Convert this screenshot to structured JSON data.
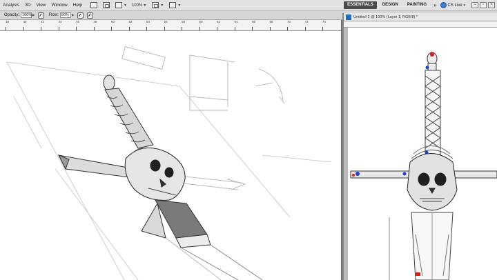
{
  "menubar": {
    "items": [
      "Analysis",
      "3D",
      "View",
      "Window",
      "Help"
    ],
    "zoom": "100%",
    "workspaces": [
      "ESSENTIALS",
      "DESIGN",
      "PAINTING"
    ],
    "more": "»",
    "cs_live": "CS Live"
  },
  "options": {
    "opacity_label": "Opacity:",
    "opacity_value": "100%",
    "flow_label": "Flow:",
    "flow_value": "80%"
  },
  "ruler": {
    "ticks": [
      "38",
      "40",
      "42",
      "44",
      "46",
      "48",
      "50",
      "52",
      "54",
      "56",
      "58",
      "60",
      "62",
      "64",
      "66",
      "68",
      "70",
      "72",
      "74"
    ]
  },
  "right_doc": {
    "title": "Untitled-2 @ 100% (Layer 1, RGB/8) *"
  },
  "colors": {
    "menubar_bg": "#e2e2e2",
    "active_workspace": "#4a4a4a",
    "ps_icon": "#1b6fc7",
    "marker_blue": "#1f3fd0",
    "marker_red": "#e01818"
  }
}
